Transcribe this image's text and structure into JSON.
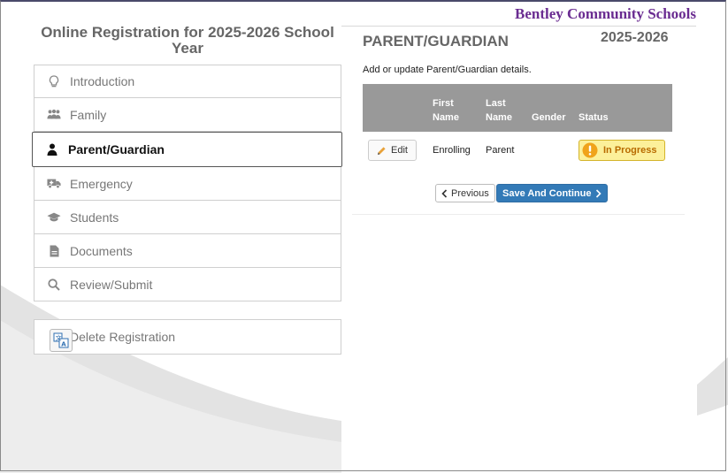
{
  "header": {
    "school_name": "Bentley Community Schools",
    "registration_title": "Online Registration for 2025-2026 School Year"
  },
  "nav": {
    "items": [
      {
        "label": "Introduction",
        "icon": "lightbulb-icon"
      },
      {
        "label": "Family",
        "icon": "family-icon"
      },
      {
        "label": "Parent/Guardian",
        "icon": "person-icon",
        "active": true
      },
      {
        "label": "Emergency",
        "icon": "ambulance-icon"
      },
      {
        "label": "Students",
        "icon": "graduation-cap-icon"
      },
      {
        "label": "Documents",
        "icon": "document-icon"
      },
      {
        "label": "Review/Submit",
        "icon": "search-icon"
      }
    ],
    "delete_label": "Delete Registration",
    "translate_icon": "translate-icon"
  },
  "panel": {
    "title": "PARENT/GUARDIAN",
    "year": "2025-2026",
    "description": "Add or update Parent/Guardian details.",
    "columns": [
      "",
      "First Name",
      "Last Name",
      "Gender",
      "Status"
    ],
    "rows": [
      {
        "edit_label": "Edit",
        "first_name": "Enrolling",
        "last_name": "Parent",
        "gender": "",
        "status": "In Progress"
      }
    ],
    "prev_label": "Previous",
    "next_label": "Save And Continue"
  },
  "colors": {
    "school_name": "#6a2c91",
    "primary_button": "#337ab7",
    "table_header": "#999999",
    "status_badge_bg": "#fcf09a",
    "status_badge_text": "#b86b00"
  }
}
